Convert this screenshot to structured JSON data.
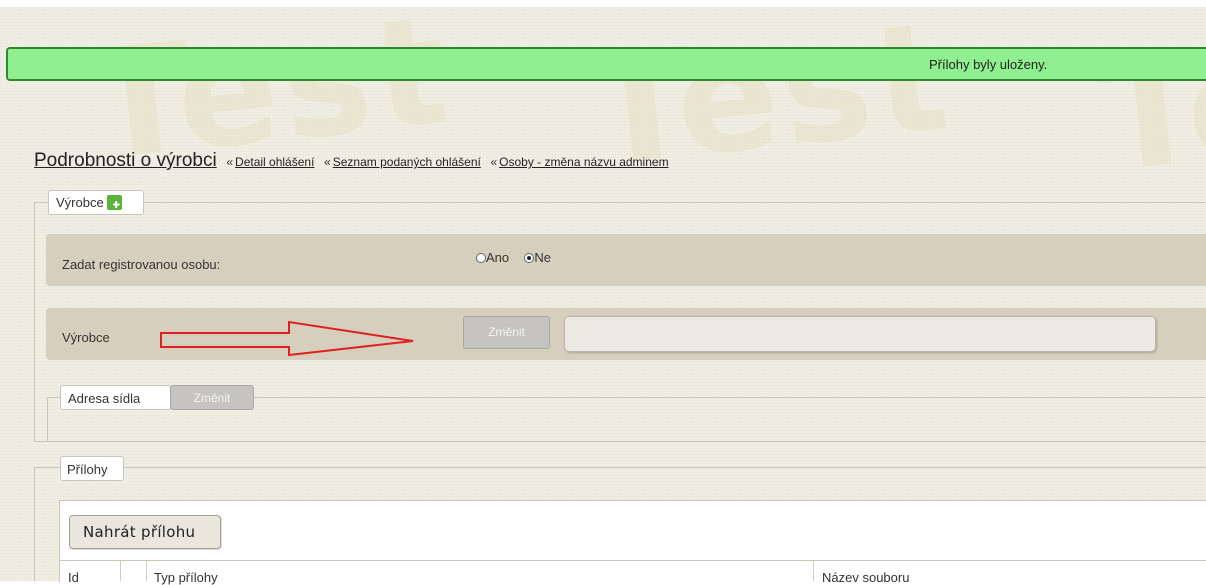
{
  "notification": {
    "text": "Přílohy byly uloženy."
  },
  "heading": {
    "title": "Podrobnosti o výrobci",
    "separator": "«",
    "breadcrumbs": [
      {
        "label": "Detail ohlášení"
      },
      {
        "label": "Seznam podaných ohlášení"
      },
      {
        "label": "Osoby - změna názvu adminem"
      }
    ]
  },
  "watermark": {
    "text": "Test"
  },
  "vyrobce_section": {
    "legend": "Výrobce",
    "add_icon": "add-document-icon",
    "registered_row": {
      "label": "Zadat registrovanou osobu:",
      "options": [
        {
          "label": "Ano",
          "checked": false
        },
        {
          "label": "Ne",
          "checked": true
        }
      ]
    },
    "vyrobce_row": {
      "label": "Výrobce",
      "change_button": "Změnit",
      "value": ""
    }
  },
  "address_section": {
    "legend": "Adresa sídla",
    "change_button": "Změnit"
  },
  "attachments_section": {
    "legend": "Přílohy",
    "upload_button": "Nahrát přílohu",
    "columns": [
      "Id",
      "",
      "Typ přílohy",
      "Název souboru"
    ]
  },
  "annotation": {
    "arrow_color": "#e02020"
  },
  "colors": {
    "success_bg": "#90ef90",
    "success_border": "#2f8a2f",
    "row_bg": "#d6cfbd"
  }
}
